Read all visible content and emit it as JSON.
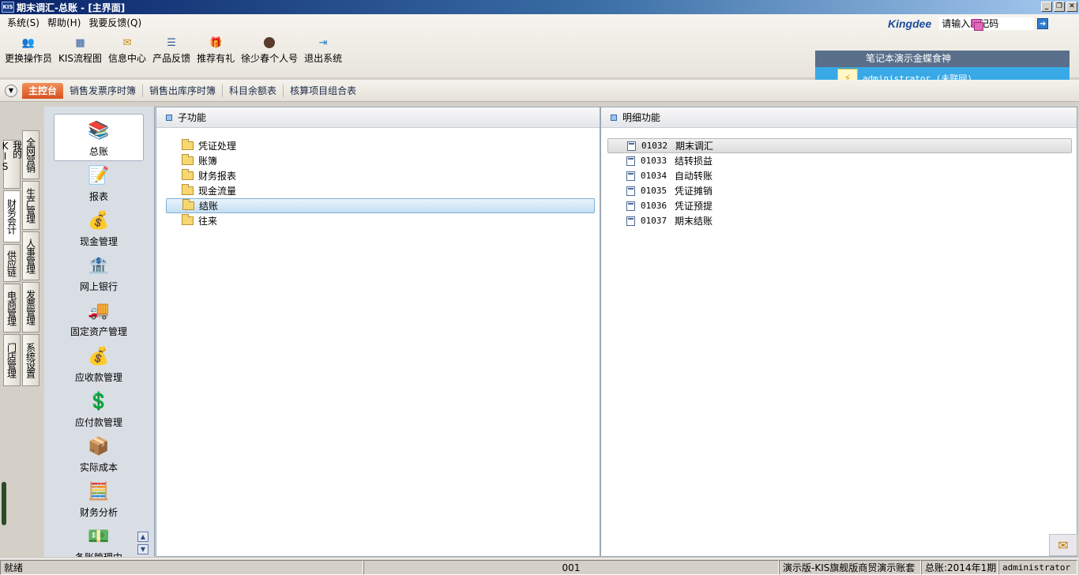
{
  "window": {
    "title": "期末调汇-总账 - [主界面]",
    "app_badge": "KIS"
  },
  "menu": [
    "系统(S)",
    "帮助(H)",
    "我要反馈(Q)"
  ],
  "toolbar": [
    {
      "label": "更换操作员",
      "icon": "users-icon"
    },
    {
      "label": "KIS流程图",
      "icon": "flowchart-icon"
    },
    {
      "label": "信息中心",
      "icon": "message-icon"
    },
    {
      "label": "产品反馈",
      "icon": "feedback-icon"
    },
    {
      "label": "推荐有礼",
      "icon": "gift-icon"
    },
    {
      "label": "徐少春个人号",
      "icon": "avatar-icon"
    },
    {
      "label": "退出系统",
      "icon": "exit-icon"
    }
  ],
  "brand": {
    "logo": "Kingdee",
    "helper_placeholder": "请输入助记码"
  },
  "user": {
    "company": "笔记本演示金蝶食神",
    "status": "administrator (未联网)"
  },
  "tabs": {
    "main": "主控台",
    "items": [
      "销售发票序时簿",
      "销售出库序时簿",
      "科目余额表",
      "核算项目组合表"
    ]
  },
  "vtabs_left": [
    "我的KIS",
    "财务会计",
    "供应链",
    "电商管理",
    "门店管理"
  ],
  "vtabs_right": [
    "全网营销",
    "生产管理",
    "人事管理",
    "发票管理",
    "系统设置"
  ],
  "modules": [
    "总账",
    "报表",
    "现金管理",
    "网上银行",
    "固定资产管理",
    "应收款管理",
    "应付款管理",
    "实际成本",
    "财务分析",
    "条账管理中"
  ],
  "subfunc": {
    "header": "子功能",
    "items": [
      "凭证处理",
      "账簿",
      "财务报表",
      "现金流量",
      "结账",
      "往来"
    ],
    "selected_index": 4
  },
  "detail": {
    "header": "明细功能",
    "items": [
      {
        "code": "01032",
        "name": "期末调汇"
      },
      {
        "code": "01033",
        "name": "结转损益"
      },
      {
        "code": "01034",
        "name": "自动转账"
      },
      {
        "code": "01035",
        "name": "凭证摊销"
      },
      {
        "code": "01036",
        "name": "凭证预提"
      },
      {
        "code": "01037",
        "name": "期末结账"
      }
    ],
    "selected_index": 0
  },
  "status": {
    "ready": "就绪",
    "code": "001",
    "account": "演示版-KIS旗舰版商贸演示账套",
    "period": "总账:2014年1期",
    "user": "administrator"
  }
}
